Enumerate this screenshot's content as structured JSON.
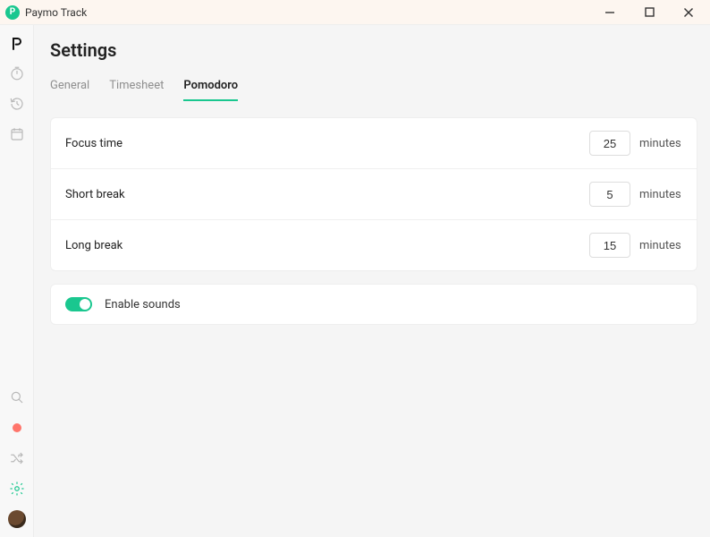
{
  "window": {
    "title": "Paymo Track"
  },
  "page": {
    "title": "Settings"
  },
  "tabs": {
    "general": "General",
    "timesheet": "Timesheet",
    "pomodoro": "Pomodoro"
  },
  "settings": {
    "focus": {
      "label": "Focus time",
      "value": "25",
      "unit": "minutes"
    },
    "short_break": {
      "label": "Short break",
      "value": "5",
      "unit": "minutes"
    },
    "long_break": {
      "label": "Long break",
      "value": "15",
      "unit": "minutes"
    }
  },
  "sounds": {
    "label": "Enable sounds",
    "enabled": true
  }
}
